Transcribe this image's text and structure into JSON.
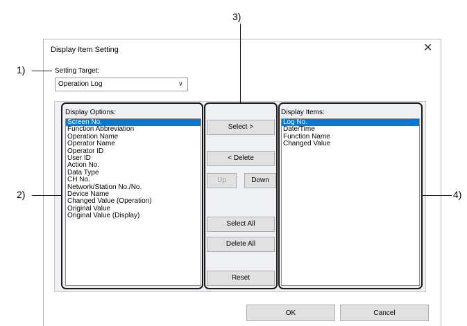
{
  "dialog": {
    "title": "Display Item Setting",
    "close_glyph": "✕"
  },
  "setting_target": {
    "label": "Setting Target:",
    "value": "Operation Log",
    "chevron": "∨"
  },
  "display_options": {
    "label": "Display Options:",
    "items": [
      "Screen No.",
      "Function Abbreviation",
      "Operation Name",
      "Operator Name",
      "Operator ID",
      "User ID",
      "Action No.",
      "Data Type",
      "CH No.",
      "Network/Station No./No.",
      "Device Name",
      "Changed Value (Operation)",
      "Original Value",
      "Original Value (Display)"
    ],
    "selected_index": 0
  },
  "display_items": {
    "label": "Display Items:",
    "items": [
      "Log No.",
      "Date/Time",
      "Function Name",
      "Changed Value"
    ],
    "selected_index": 0
  },
  "buttons": {
    "select": "Select >",
    "delete": "< Delete",
    "up": "Up",
    "down": "Down",
    "select_all": "Select All",
    "delete_all": "Delete All",
    "reset": "Reset",
    "ok": "OK",
    "cancel": "Cancel"
  },
  "callouts": {
    "c1": "1)",
    "c2": "2)",
    "c3": "3)",
    "c4": "4)"
  },
  "colors": {
    "selection": "#0078d7",
    "marker": "#1a1a1a"
  }
}
